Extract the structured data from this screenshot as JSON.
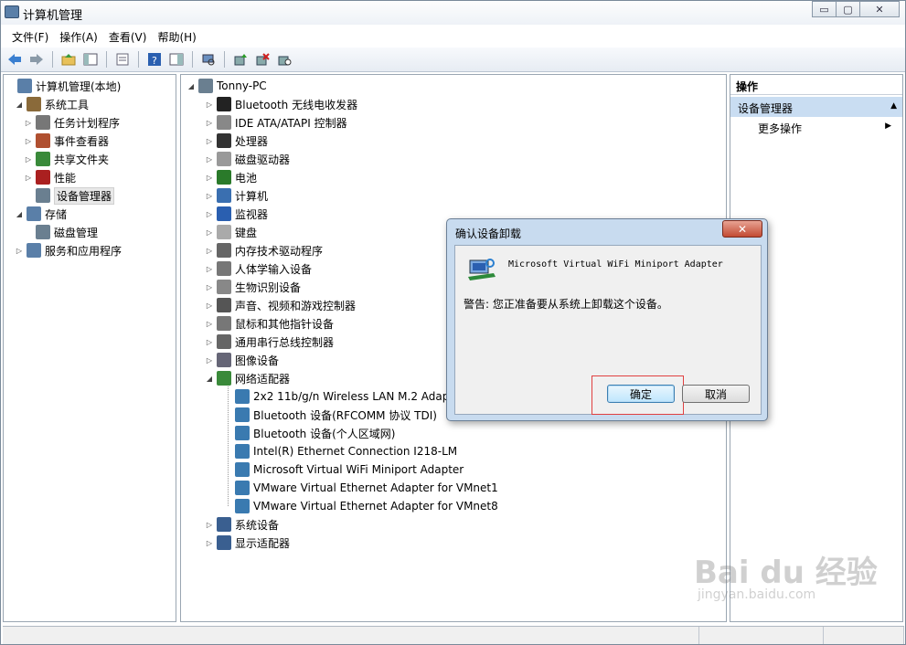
{
  "window": {
    "title": "计算机管理"
  },
  "window_controls": {
    "minimize": "▭",
    "maximize": "▢",
    "close": "✕"
  },
  "menu": [
    "文件(F)",
    "操作(A)",
    "查看(V)",
    "帮助(H)"
  ],
  "toolbar_icons": [
    "back-icon",
    "forward-icon",
    "up-icon",
    "show-hide-tree-icon",
    "export-list-icon",
    "help-icon",
    "action-pane-icon",
    "scan-hardware-icon",
    "update-driver-icon",
    "uninstall-icon",
    "disable-icon"
  ],
  "left_tree": [
    {
      "label": "计算机管理(本地)",
      "level": 0,
      "arrow": ""
    },
    {
      "label": "系统工具",
      "level": 1,
      "arrow": "◢"
    },
    {
      "label": "任务计划程序",
      "level": 2,
      "arrow": "▷"
    },
    {
      "label": "事件查看器",
      "level": 2,
      "arrow": "▷"
    },
    {
      "label": "共享文件夹",
      "level": 2,
      "arrow": "▷"
    },
    {
      "label": "性能",
      "level": 2,
      "arrow": "▷"
    },
    {
      "label": "设备管理器",
      "level": 2,
      "arrow": "",
      "selected": true
    },
    {
      "label": "存储",
      "level": 1,
      "arrow": "◢"
    },
    {
      "label": "磁盘管理",
      "level": 2,
      "arrow": ""
    },
    {
      "label": "服务和应用程序",
      "level": 1,
      "arrow": "▷"
    }
  ],
  "device_tree": {
    "root": "Tonny-PC",
    "categories": [
      "Bluetooth 无线电收发器",
      "IDE ATA/ATAPI 控制器",
      "处理器",
      "磁盘驱动器",
      "电池",
      "计算机",
      "监视器",
      "键盘",
      "内存技术驱动程序",
      "人体学输入设备",
      "生物识别设备",
      "声音、视频和游戏控制器",
      "鼠标和其他指针设备",
      "通用串行总线控制器",
      "图像设备",
      "网络适配器"
    ],
    "network_adapters": [
      "2x2 11b/g/n Wireless LAN M.2 Adap",
      "Bluetooth 设备(RFCOMM 协议 TDI)",
      "Bluetooth 设备(个人区域网)",
      "Intel(R) Ethernet Connection I218-LM",
      "Microsoft Virtual WiFi Miniport Adapter",
      "VMware Virtual Ethernet Adapter for VMnet1",
      "VMware Virtual Ethernet Adapter for VMnet8"
    ],
    "after": [
      "系统设备",
      "显示适配器"
    ]
  },
  "actions": {
    "header": "操作",
    "section": "设备管理器",
    "more": "更多操作"
  },
  "dialog": {
    "title": "确认设备卸载",
    "close": "✕",
    "device": "Microsoft Virtual WiFi Miniport Adapter",
    "warning": "警告: 您正准备要从系统上卸载这个设备。",
    "ok": "确定",
    "cancel": "取消"
  },
  "watermark": {
    "brand": "Bai du 经验",
    "url": "jingyan.baidu.com"
  }
}
